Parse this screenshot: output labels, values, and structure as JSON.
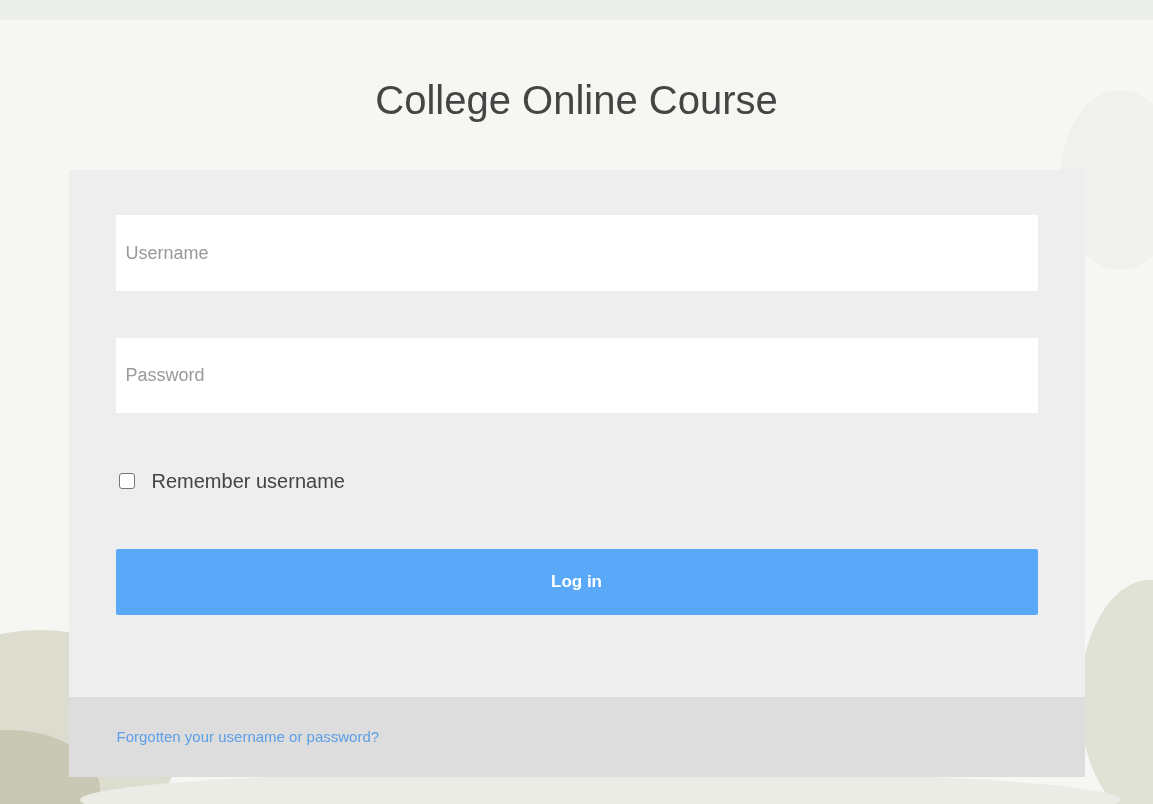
{
  "title": "College Online Course",
  "username": {
    "placeholder": "Username"
  },
  "password": {
    "placeholder": "Password"
  },
  "remember": {
    "label": "Remember username",
    "checked": false
  },
  "login_button": "Log in",
  "footer_link": "Forgotten your username or password?"
}
